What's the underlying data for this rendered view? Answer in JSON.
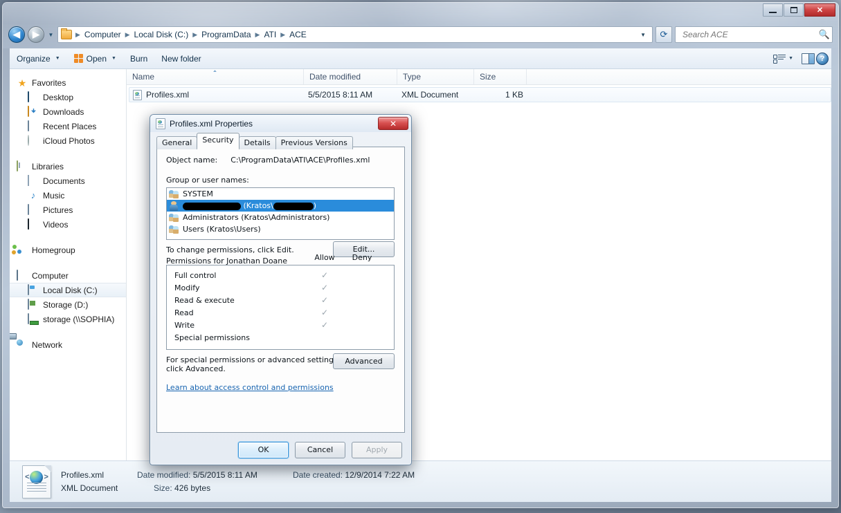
{
  "window": {
    "title": "ACE",
    "controls": {
      "minimize": "Minimize",
      "maximize": "Maximize",
      "close": "Close"
    }
  },
  "address_bar": {
    "back_label": "Back",
    "forward_label": "Forward",
    "history_label": "Recent pages",
    "breadcrumbs": [
      "Computer",
      "Local Disk (C:)",
      "ProgramData",
      "ATI",
      "ACE"
    ],
    "refresh_label": "Refresh"
  },
  "search": {
    "placeholder": "Search ACE",
    "value": "",
    "icon": "search-icon"
  },
  "toolbar": {
    "organize": "Organize",
    "open": "Open",
    "burn": "Burn",
    "new_folder": "New folder",
    "change_view": "Change your view",
    "show_preview": "Show the preview pane",
    "help": "?"
  },
  "nav_pane": {
    "groups": [
      {
        "header": {
          "label": "Favorites",
          "icon": "star-icon"
        },
        "items": [
          {
            "label": "Desktop",
            "icon": "desktop-icon"
          },
          {
            "label": "Downloads",
            "icon": "downloads-folder-icon"
          },
          {
            "label": "Recent Places",
            "icon": "recent-places-icon"
          },
          {
            "label": "iCloud Photos",
            "icon": "icloud-photos-icon"
          }
        ]
      },
      {
        "header": {
          "label": "Libraries",
          "icon": "libraries-icon"
        },
        "items": [
          {
            "label": "Documents",
            "icon": "documents-icon"
          },
          {
            "label": "Music",
            "icon": "music-icon"
          },
          {
            "label": "Pictures",
            "icon": "pictures-icon"
          },
          {
            "label": "Videos",
            "icon": "videos-icon"
          }
        ]
      },
      {
        "header": {
          "label": "Homegroup",
          "icon": "homegroup-icon"
        },
        "items": []
      },
      {
        "header": {
          "label": "Computer",
          "icon": "computer-icon"
        },
        "items": [
          {
            "label": "Local Disk (C:)",
            "icon": "local-disk-icon",
            "selected": true
          },
          {
            "label": "Storage (D:)",
            "icon": "storage-disk-icon"
          },
          {
            "label": "storage (\\\\SOPHIA)",
            "icon": "network-drive-icon"
          }
        ]
      },
      {
        "header": {
          "label": "Network",
          "icon": "network-icon"
        },
        "items": []
      }
    ]
  },
  "file_list": {
    "columns": [
      "Name",
      "Date modified",
      "Type",
      "Size"
    ],
    "sorted_column": "Name",
    "rows": [
      {
        "icon": "xml-file-icon",
        "name": "Profiles.xml",
        "date_modified": "5/5/2015 8:11 AM",
        "type": "XML Document",
        "size": "1 KB",
        "selected": true
      }
    ]
  },
  "status_bar": {
    "icon": "xml-document-large-icon",
    "file_name": "Profiles.xml",
    "file_type": "XML Document",
    "date_modified_label": "Date modified:",
    "date_modified_value": "5/5/2015 8:11 AM",
    "date_created_label": "Date created:",
    "date_created_value": "12/9/2014 7:22 AM",
    "size_label": "Size:",
    "size_value": "426 bytes"
  },
  "dialog": {
    "title": "Profiles.xml Properties",
    "icon": "xml-file-icon",
    "close_label": "✕",
    "tabs": [
      {
        "label": "General",
        "active": false
      },
      {
        "label": "Security",
        "active": true
      },
      {
        "label": "Details",
        "active": false
      },
      {
        "label": "Previous Versions",
        "active": false
      }
    ],
    "object_name_label": "Object name:",
    "object_name_value": "C:\\ProgramData\\ATI\\ACE\\Profiles.xml",
    "group_users_label": "Group or user names:",
    "group_users": [
      {
        "name": "SYSTEM",
        "icon": "group-icon",
        "selected": false,
        "redacted": false
      },
      {
        "name": "",
        "icon": "user-icon",
        "selected": true,
        "redacted": true,
        "redacted_prefix_width": 84,
        "middle_text": "(Kratos\\",
        "redacted_suffix_width": 58,
        "suffix_text": ")"
      },
      {
        "name": "Administrators (Kratos\\Administrators)",
        "icon": "group-icon",
        "selected": false,
        "redacted": false
      },
      {
        "name": "Users (Kratos\\Users)",
        "icon": "group-icon",
        "selected": false,
        "redacted": false
      }
    ],
    "edit_hint": "To change permissions, click Edit.",
    "edit_button": "Edit...",
    "permissions_label": "Permissions for Jonathan Doane",
    "allow_header": "Allow",
    "deny_header": "Deny",
    "permissions": [
      {
        "name": "Full control",
        "allow": "✓",
        "deny": ""
      },
      {
        "name": "Modify",
        "allow": "✓",
        "deny": ""
      },
      {
        "name": "Read & execute",
        "allow": "✓",
        "deny": ""
      },
      {
        "name": "Read",
        "allow": "✓",
        "deny": ""
      },
      {
        "name": "Write",
        "allow": "✓",
        "deny": ""
      },
      {
        "name": "Special permissions",
        "allow": "",
        "deny": ""
      }
    ],
    "advanced_hint_line1": "For special permissions or advanced settings,",
    "advanced_hint_line2": "click Advanced.",
    "advanced_button": "Advanced",
    "learn_link": "Learn about access control and permissions",
    "ok_button": "OK",
    "cancel_button": "Cancel",
    "apply_button": "Apply"
  },
  "colors": {
    "selection_blue": "#2a8cdb",
    "link_blue": "#1764b0",
    "close_red": "#b62c2c",
    "accent_orange": "#ef8b26"
  }
}
